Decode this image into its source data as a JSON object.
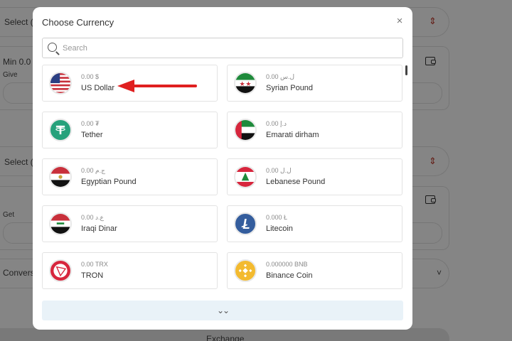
{
  "background": {
    "select_label_1": "Select (",
    "min_label": "Min 0.0",
    "give_label": "Give",
    "select_label_2": "Select (",
    "get_label": "Get",
    "conversion_label": "Convers",
    "exchange_label": "Exchange"
  },
  "modal": {
    "title": "Choose Currency",
    "close_symbol": "×",
    "search_placeholder": "Search",
    "more_symbol": "⌄⌄"
  },
  "currencies": [
    {
      "name": "US Dollar",
      "balance": "0.00 $",
      "icon": "us-flag-icon"
    },
    {
      "name": "Syrian Pound",
      "balance": "0.00 ل.س",
      "icon": "syria-flag-icon"
    },
    {
      "name": "Tether",
      "balance": "0.00 ₮",
      "icon": "tether-icon"
    },
    {
      "name": "Emarati dirham",
      "balance": "0.00 د.إ",
      "icon": "uae-flag-icon"
    },
    {
      "name": "Egyptian Pound",
      "balance": "0.00 ج.م",
      "icon": "egypt-flag-icon"
    },
    {
      "name": "Lebanese Pound",
      "balance": "0.00 ل.ل",
      "icon": "lebanon-flag-icon"
    },
    {
      "name": "Iraqi Dinar",
      "balance": "0.00 ع.د",
      "icon": "iraq-flag-icon"
    },
    {
      "name": "Litecoin",
      "balance": "0.000 Ł",
      "icon": "litecoin-icon"
    },
    {
      "name": "TRON",
      "balance": "0.00 TRX",
      "icon": "tron-icon"
    },
    {
      "name": "Binance Coin",
      "balance": "0.000000 BNB",
      "icon": "bnb-icon"
    }
  ],
  "colors": {
    "annotation_arrow": "#e02020",
    "tether": "#26a17b",
    "litecoin": "#345d9d",
    "tron": "#d7263d",
    "bnb": "#f3ba2f"
  }
}
